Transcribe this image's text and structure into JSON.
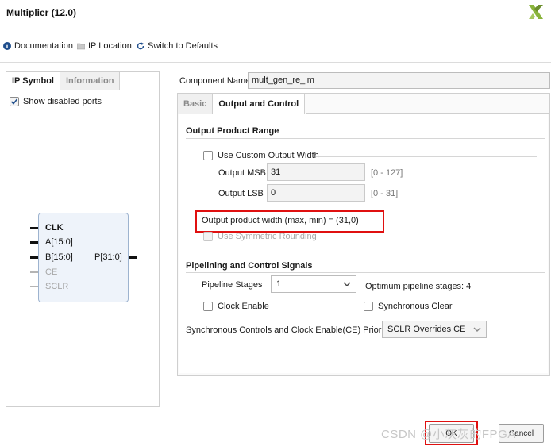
{
  "window": {
    "title": "Multiplier (12.0)"
  },
  "toolbar": {
    "documentation": "Documentation",
    "ip_location": "IP Location",
    "switch_defaults": "Switch to Defaults"
  },
  "left": {
    "tabs": [
      "IP Symbol",
      "Information"
    ],
    "show_disabled_ports": "Show disabled ports",
    "ports": {
      "clk": "CLK",
      "a": "A[15:0]",
      "b": "B[15:0]",
      "ce": "CE",
      "sclr": "SCLR",
      "p": "P[31:0]"
    }
  },
  "component": {
    "label": "Component Name",
    "value": "mult_gen_re_lm"
  },
  "tabs": [
    "Basic",
    "Output and Control"
  ],
  "output_range": {
    "title": "Output Product Range",
    "use_custom": "Use Custom Output Width",
    "msb_label": "Output MSB",
    "msb_value": "31",
    "msb_range": "[0 - 127]",
    "lsb_label": "Output LSB",
    "lsb_value": "0",
    "lsb_range": "[0 - 31]",
    "width_text": "Output product width (max, min) = (31,0)",
    "symmetric": "Use Symmetric Rounding"
  },
  "pipelining": {
    "title": "Pipelining and Control Signals",
    "stages_label": "Pipeline Stages",
    "stages_value": "1",
    "optimum": "Optimum pipeline stages: 4",
    "clock_enable": "Clock Enable",
    "sync_clear": "Synchronous Clear",
    "priority_label": "Synchronous Controls and Clock Enable(CE) Priority",
    "priority_value": "SCLR Overrides CE"
  },
  "buttons": {
    "ok": "OK",
    "cancel": "Cancel"
  },
  "watermark": "CSDN @小灰灰的FPGA",
  "colors": {
    "highlight": "#e01010",
    "logo": "#8ab43c",
    "ip_block": "#eef3fa"
  }
}
